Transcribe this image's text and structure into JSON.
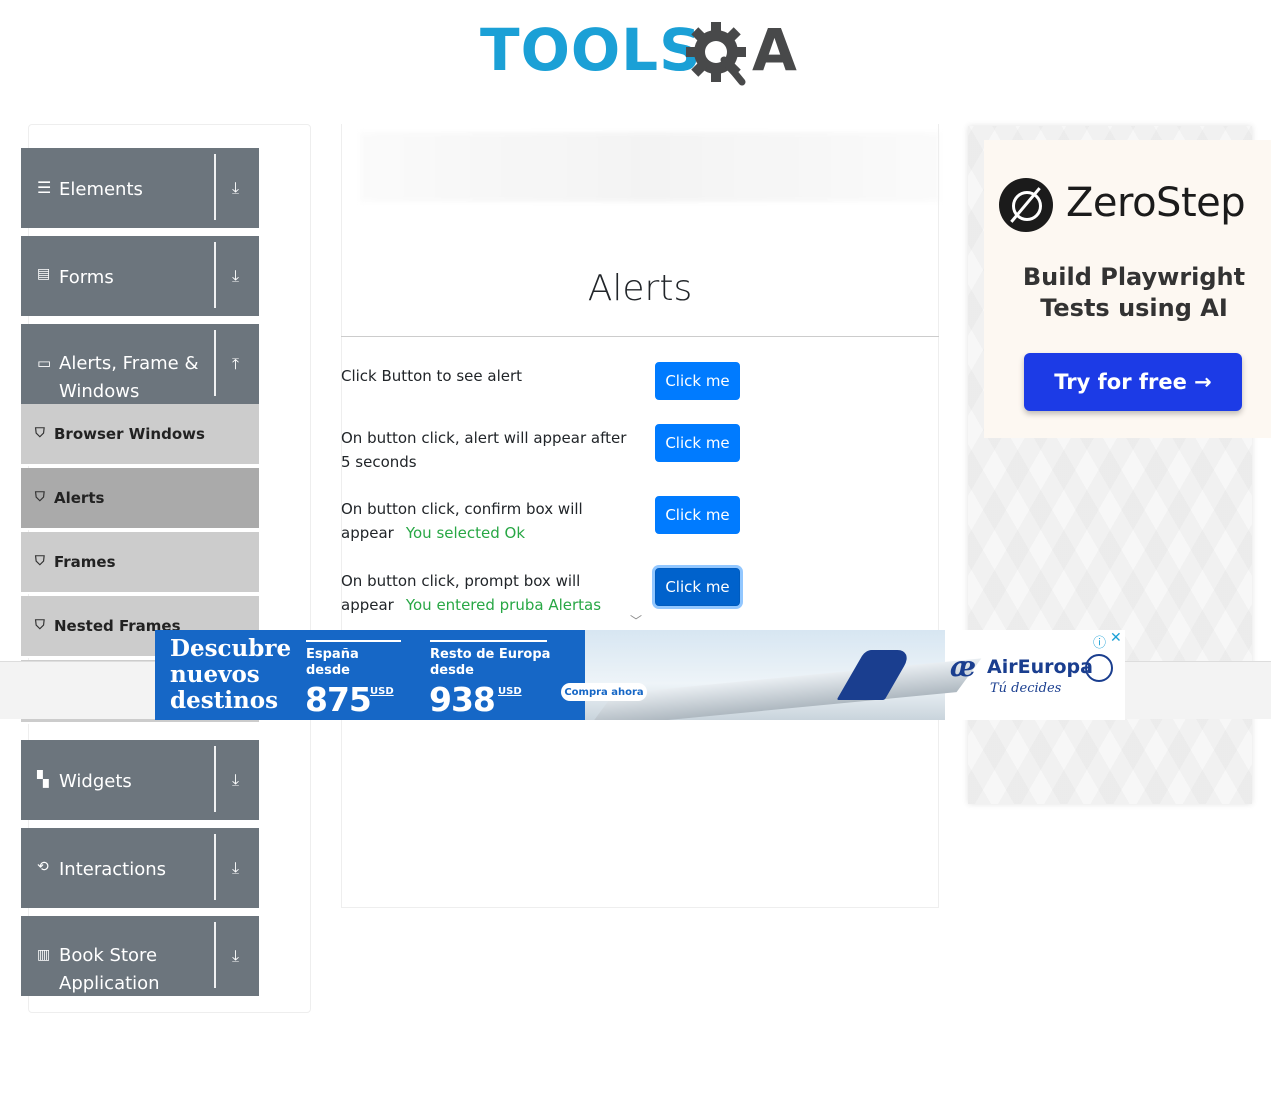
{
  "header": {
    "logo_tools": "TOOLS",
    "logo_a": "A",
    "colors": {
      "tools": "#1ba0d6",
      "qa": "#48494a"
    }
  },
  "sidebar": {
    "groups": [
      {
        "label": "Elements",
        "icon": "hamburger-icon",
        "arrow": "download-arrow-icon"
      },
      {
        "label": "Forms",
        "icon": "document-icon",
        "arrow": "download-arrow-icon"
      },
      {
        "label": "Alerts, Frame & Windows",
        "icon": "window-icon",
        "arrow": "upload-arrow-icon"
      },
      {
        "label": "Widgets",
        "icon": "widgets-icon",
        "arrow": "download-arrow-icon"
      },
      {
        "label": "Interactions",
        "icon": "interactions-icon",
        "arrow": "download-arrow-icon"
      },
      {
        "label": "Book Store Application",
        "icon": "books-icon",
        "arrow": "download-arrow-icon"
      }
    ],
    "sub_items": [
      {
        "label": "Browser Windows",
        "icon": "html5-icon",
        "active": false
      },
      {
        "label": "Alerts",
        "icon": "html5-icon",
        "active": true
      },
      {
        "label": "Frames",
        "icon": "html5-icon",
        "active": false
      },
      {
        "label": "Nested Frames",
        "icon": "html5-icon",
        "active": false
      }
    ]
  },
  "main": {
    "title": "Alerts",
    "rows": [
      {
        "text": "Click Button to see alert",
        "result": "",
        "button": "Click me"
      },
      {
        "text": "On button click, alert will appear after 5 seconds",
        "result": "",
        "button": "Click me"
      },
      {
        "text": "On button click, confirm box will appear",
        "result": "You selected Ok",
        "button": "Click me"
      },
      {
        "text": "On button click, prompt box will appear",
        "result": "You entered pruba Alertas",
        "button": "Click me"
      }
    ],
    "colors": {
      "button": "#007bff",
      "result": "#28a745"
    }
  },
  "right_ad": {
    "brand": "ZeroStep",
    "tagline": "Build Playwright Tests using AI",
    "cta": "Try for free →",
    "cta_color": "#1c3be6"
  },
  "bottom_ad": {
    "headline": "Descubre nuevos destinos",
    "col1_label": "España desde",
    "col1_price": "875",
    "col2_label": "Resto de Europa desde",
    "col2_price": "938",
    "currency": "USD",
    "cta": "Compra ahora",
    "brand_mark": "æ",
    "brand": "AirEuropa",
    "slogan": "Tú decides",
    "info": "ⓘ",
    "close": "✕",
    "brand_color": "#1a3e8f"
  }
}
